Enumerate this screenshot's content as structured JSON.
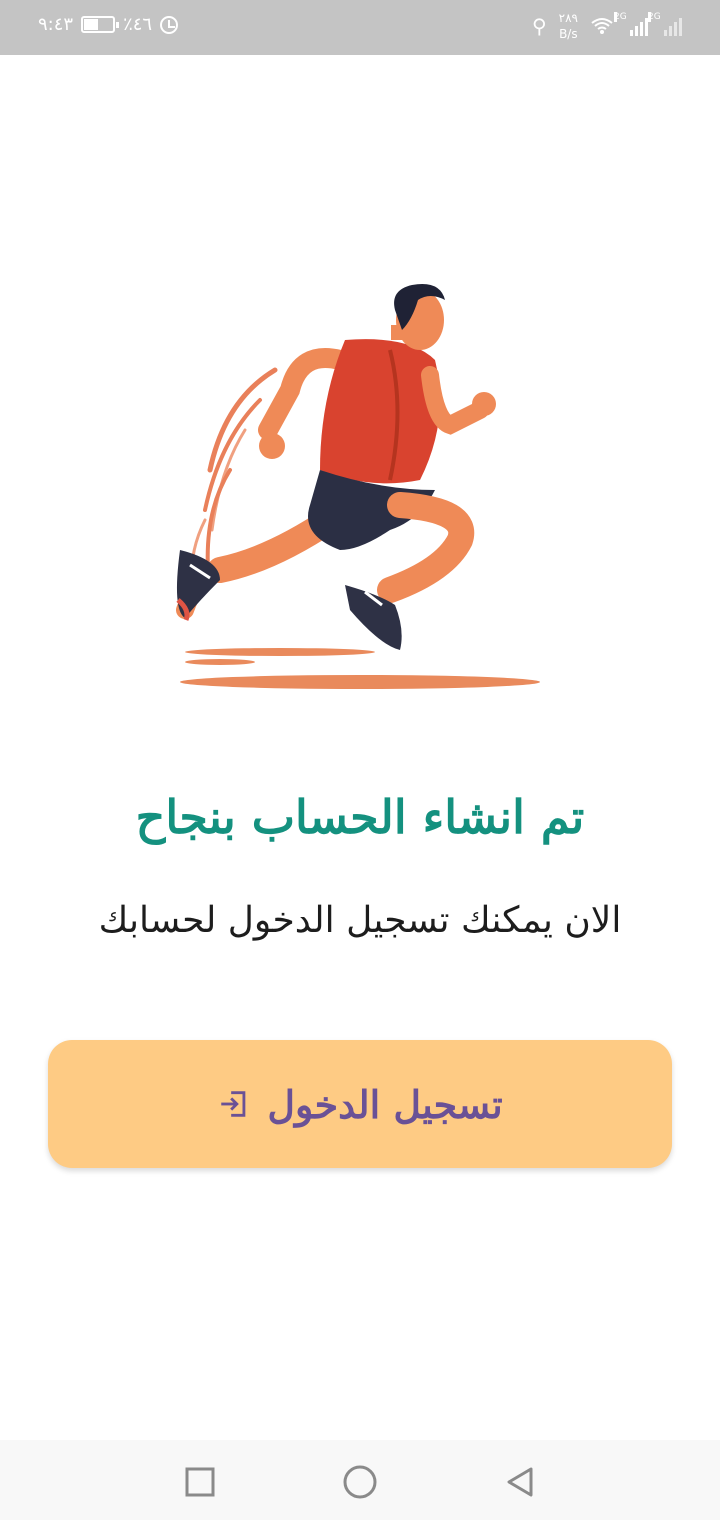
{
  "status_bar": {
    "time": "٩:٤٣",
    "battery_percent": "٪٤٦",
    "battery_level": 0.46,
    "network_speed_value": "٢٨٩",
    "network_speed_unit": "B/s",
    "sim1_label": "2G",
    "sim2_label": "2G"
  },
  "hero": {
    "illustration": "running-man"
  },
  "main": {
    "title": "تم انشاء الحساب بنجاح",
    "subtitle": "الان يمكنك تسجيل الدخول لحسابك"
  },
  "login_button": {
    "label": "تسجيل الدخول",
    "icon": "login-icon"
  },
  "nav_bar": {
    "recent": "square-icon",
    "home": "circle-icon",
    "back": "triangle-icon"
  },
  "colors": {
    "title": "#14917f",
    "button_bg": "#fecb84",
    "button_text": "#6a5196",
    "status_bar": "#c4c4c4"
  }
}
